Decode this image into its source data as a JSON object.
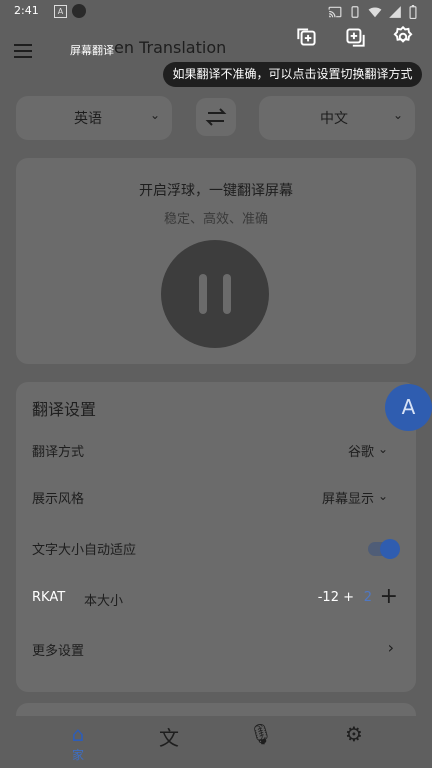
{
  "status": {
    "time": "2:41",
    "a_badge": "A"
  },
  "appbar": {
    "title_overlay": "屏幕翻译",
    "title_main": "en Translation",
    "tooltip": "如果翻译不准确，可以点击设置切换翻译方式",
    "icons": [
      "copy-add-icon",
      "add-copy-icon",
      "settings-gear-icon"
    ]
  },
  "languages": {
    "source": "英语",
    "target": "中文"
  },
  "hero": {
    "title": "开启浮球，一键翻译屏幕",
    "subtitle": "稳定、高效、准确"
  },
  "settings": {
    "heading": "翻译设置",
    "translation_method_label": "翻译方式",
    "translation_method_value": "谷歌",
    "display_style_label": "展示风格",
    "display_style_value": "屏幕显示",
    "auto_size_label": "文字大小自动适应",
    "text_size_overlay": "RKAT",
    "text_size_label": "本大小",
    "text_size_minus": "-12 +",
    "text_size_value": "2",
    "more_settings_label": "更多设置"
  },
  "bottom_nav": {
    "home_label": "家"
  },
  "colors": {
    "accent": "#2f5db0",
    "background": "#5f5f5f",
    "card": "#6b6b6b"
  }
}
